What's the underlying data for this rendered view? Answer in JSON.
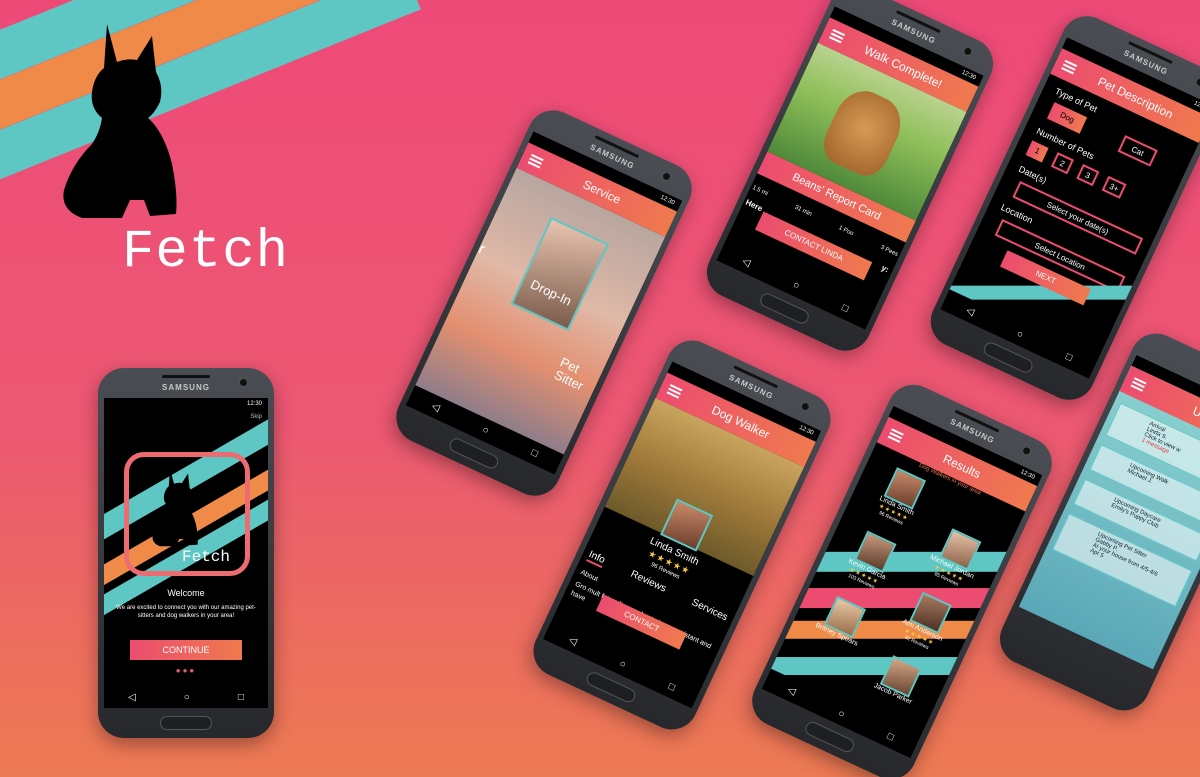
{
  "brand": {
    "name": "Fetch"
  },
  "colors": {
    "pink": "#ee4a78",
    "orange": "#ef7a4e",
    "teal": "#5ec7c4",
    "black": "#000000"
  },
  "phone_brand": "SAMSUNG",
  "status_time": "12:30",
  "nav_icons": {
    "back": "◁",
    "home": "○",
    "recent": "□"
  },
  "welcome": {
    "skip": "Skip",
    "logo_text": "Fetch",
    "title": "Welcome",
    "body": "We are excited to connect you with our amazing pet-sitters and dog walkers in your area!",
    "continue": "CONTINUE"
  },
  "service": {
    "title": "Service",
    "tile_left": "er",
    "tile_center": "Drop-In",
    "tile_right": "Pet Sitter"
  },
  "walk": {
    "title": "Walk Complete!",
    "report": "Beans' Report Card",
    "stats": [
      "1.5 mi",
      "31 min",
      "1 Poo",
      "3 Pees"
    ],
    "here_label": "Here",
    "here_suffix": "y:",
    "contact": "CONTACT LINDA"
  },
  "pet": {
    "title": "Pet Description",
    "type_label": "Type of Pet",
    "dog": "Dog",
    "cat": "Cat",
    "num_label": "Number of Pets",
    "nums": [
      "1",
      "2",
      "3",
      "3+"
    ],
    "dates_label": "Date(s)",
    "dates_btn": "Select your date(s)",
    "location_label": "Location",
    "location_btn": "Select Location",
    "next": "NEXT"
  },
  "walker": {
    "title": "Dog Walker",
    "name": "Linda Smith",
    "stars": "★★★★★",
    "reviews": "96 Reviews",
    "tabs": [
      "Info",
      "Reviews",
      "Services"
    ],
    "about_label": "About",
    "body_frag": "Gro mult fetc a licensed veterinary assistant and have",
    "contact": "CONTACT"
  },
  "results": {
    "title": "Results",
    "subtitle": "Dog Walkers in your area",
    "people": [
      {
        "name": "Linda Smith",
        "stars": "★★★★★",
        "reviews": "96 Reviews"
      },
      {
        "name": "Michael Jordan",
        "stars": "★★★★★",
        "reviews": "85 Reviews"
      },
      {
        "name": "Kevin Garcia",
        "stars": "★★★★★",
        "reviews": "103 Reviews"
      },
      {
        "name": "Ami Anderson",
        "stars": "★★★★★",
        "reviews": "92 Reviews"
      },
      {
        "name": "Britney Spears",
        "stars": "",
        "reviews": ""
      },
      {
        "name": "Jacob Parker",
        "stars": "",
        "reviews": ""
      }
    ]
  },
  "upcoming": {
    "title_frag": "U",
    "items": [
      {
        "kind": "Arrival",
        "who": "Linda S.",
        "line": "Click to view w",
        "badge": "1 message"
      },
      {
        "kind": "Upcoming Walk",
        "who": "Michael J.",
        "line": "",
        "badge": ""
      },
      {
        "kind": "Upcoming Daycare",
        "who": "Emily's Puppy Club",
        "line": "",
        "badge": ""
      },
      {
        "kind": "Upcoming Pet Sitter",
        "who": "Gabby P.",
        "line": "At your house from 4/5-4/6",
        "badge": "Apr 5"
      }
    ]
  }
}
